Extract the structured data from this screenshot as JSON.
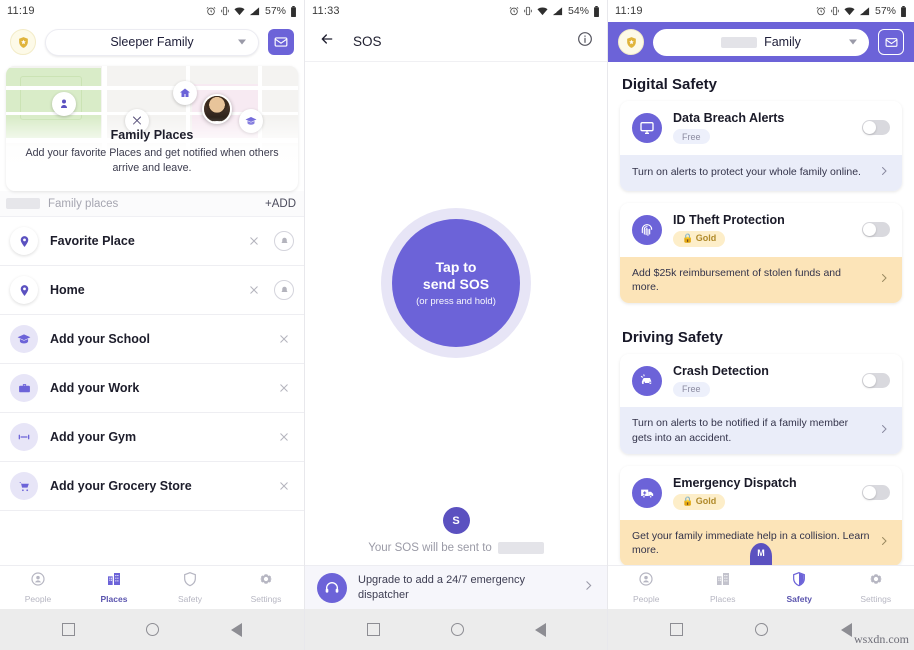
{
  "panel1": {
    "status": {
      "time": "11:19",
      "battery": "57%"
    },
    "header": {
      "family_label": "Sleeper Family",
      "badge_icon": "shield-star-icon",
      "mail_icon": "mail-icon",
      "caret_icon": "chevron-down-icon"
    },
    "map_card": {
      "title": "Family Places",
      "subtitle": "Add your favorite Places and get notified when others arrive and leave.",
      "pins": [
        "park-icon",
        "home-icon",
        "restaurant-icon",
        "school-icon",
        "member-avatar"
      ]
    },
    "family_places_bar": {
      "label": "Family places",
      "add_label": "+ADD"
    },
    "places": [
      {
        "label": "Favorite Place",
        "icon": "map-pin-icon",
        "icon_style": "white",
        "has_bell": true,
        "close_icon": "close-icon",
        "bell_icon": "bell-icon"
      },
      {
        "label": "Home",
        "icon": "map-pin-icon",
        "icon_style": "white",
        "has_bell": true,
        "close_icon": "close-icon",
        "bell_icon": "bell-icon"
      },
      {
        "label": "Add your School",
        "icon": "school-icon",
        "icon_style": "lavender",
        "has_bell": false,
        "close_icon": "close-icon",
        "bell_icon": ""
      },
      {
        "label": "Add your Work",
        "icon": "briefcase-icon",
        "icon_style": "lavender",
        "has_bell": false,
        "close_icon": "close-icon",
        "bell_icon": ""
      },
      {
        "label": "Add your Gym",
        "icon": "dumbbell-icon",
        "icon_style": "lavender",
        "has_bell": false,
        "close_icon": "close-icon",
        "bell_icon": ""
      },
      {
        "label": "Add your Grocery Store",
        "icon": "shopping-cart-icon",
        "icon_style": "lavender",
        "has_bell": false,
        "close_icon": "close-icon",
        "bell_icon": ""
      }
    ],
    "tabs": [
      {
        "label": "People",
        "icon": "person-circle-icon",
        "active": false
      },
      {
        "label": "Places",
        "icon": "buildings-icon",
        "active": true
      },
      {
        "label": "Safety",
        "icon": "shield-icon",
        "active": false
      },
      {
        "label": "Settings",
        "icon": "gear-icon",
        "active": false
      }
    ]
  },
  "panel2": {
    "status": {
      "time": "11:33",
      "battery": "54%"
    },
    "header": {
      "title": "SOS",
      "back_icon": "back-arrow-icon",
      "info_icon": "info-icon"
    },
    "sos_button": {
      "line1": "Tap to",
      "line2": "send SOS",
      "hint": "(or press and hold)"
    },
    "footer": {
      "avatar_initial": "S",
      "sent_to_text": "Your SOS will be sent to"
    },
    "upgrade": {
      "text": "Upgrade to add a 24/7 emergency dispatcher",
      "icon": "headset-icon",
      "chevron": "chevron-right-icon"
    }
  },
  "panel3": {
    "status": {
      "time": "11:19",
      "battery": "57%"
    },
    "header": {
      "family_label": "Family",
      "badge_icon": "shield-star-icon",
      "mail_icon": "mail-icon",
      "caret_icon": "chevron-down-icon"
    },
    "sections": [
      {
        "heading": "Digital Safety",
        "cards": [
          {
            "title": "Data Breach Alerts",
            "tag": "Free",
            "tag_type": "free",
            "icon": "monitor-icon",
            "toggle_on": false,
            "footer_text": "Turn on alerts to protect your whole family online.",
            "footer_style": "blue",
            "chevron": "chevron-right-icon"
          },
          {
            "title": "ID Theft Protection",
            "tag": "Gold",
            "tag_type": "gold",
            "icon": "fingerprint-icon",
            "toggle_on": false,
            "footer_text": "Add $25k reimbursement of stolen funds and more.",
            "footer_style": "amber",
            "chevron": "chevron-right-icon"
          }
        ]
      },
      {
        "heading": "Driving Safety",
        "cards": [
          {
            "title": "Crash Detection",
            "tag": "Free",
            "tag_type": "free",
            "icon": "car-crash-icon",
            "toggle_on": false,
            "footer_text": "Turn on alerts to be notified if a family member gets into an accident.",
            "footer_style": "blue",
            "chevron": "chevron-right-icon"
          },
          {
            "title": "Emergency Dispatch",
            "tag": "Gold",
            "tag_type": "gold",
            "icon": "ambulance-icon",
            "toggle_on": false,
            "footer_text": "Get your family immediate help in a collision. Learn more.",
            "footer_style": "amber",
            "chevron": "chevron-right-icon"
          }
        ]
      }
    ],
    "member_badge": "M",
    "tabs": [
      {
        "label": "People",
        "icon": "person-circle-icon",
        "active": false
      },
      {
        "label": "Places",
        "icon": "buildings-icon",
        "active": false
      },
      {
        "label": "Safety",
        "icon": "shield-icon",
        "active": true
      },
      {
        "label": "Settings",
        "icon": "gear-icon",
        "active": false
      }
    ]
  },
  "watermark": "wsxdn.com",
  "colors": {
    "primary": "#6c63d8",
    "accent_gold": "#fdeec9",
    "footer_blue": "#eaedf9",
    "footer_amber": "#fce4b8"
  }
}
